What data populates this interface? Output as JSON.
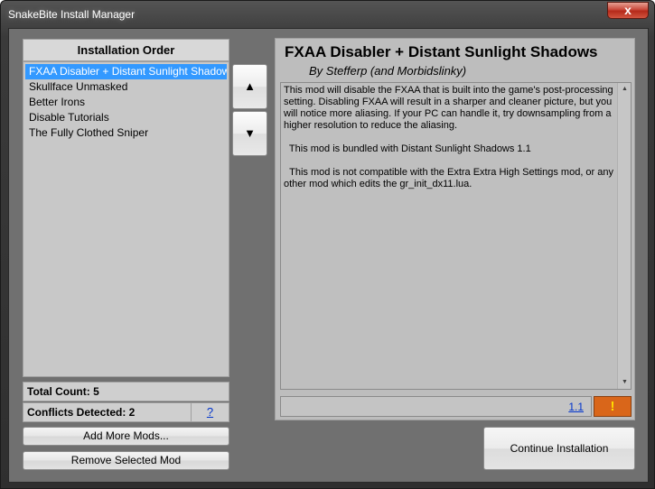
{
  "window": {
    "title": "SnakeBite Install Manager",
    "close_glyph": "x"
  },
  "installation_order": {
    "header": "Installation Order",
    "items": [
      {
        "label": "FXAA Disabler + Distant Sunlight Shadows",
        "selected": true
      },
      {
        "label": "Skullface Unmasked",
        "selected": false
      },
      {
        "label": "Better Irons",
        "selected": false
      },
      {
        "label": "Disable Tutorials",
        "selected": false
      },
      {
        "label": "The Fully Clothed Sniper",
        "selected": false
      }
    ],
    "move_up_glyph": "▲",
    "move_down_glyph": "▼"
  },
  "stats": {
    "total_count": "Total Count: 5",
    "conflicts_detected": "Conflicts Detected: 2",
    "help_label": "?"
  },
  "buttons": {
    "add_more_mods": "Add More Mods...",
    "remove_selected_mod": "Remove Selected Mod",
    "continue_installation": "Continue Installation"
  },
  "mod_details": {
    "title": "FXAA Disabler + Distant Sunlight Shadows",
    "author": "By Stefferp (and Morbidslinky)",
    "description": [
      "This mod will disable the FXAA that is built into the game's post-processing setting. Disabling FXAA will result in a sharper and cleaner picture, but you will notice more aliasing. If your PC can handle it, try downsampling from a higher resolution to reduce the aliasing.",
      "  This mod is bundled with Distant Sunlight Shadows 1.1",
      "  This mod is not compatible with the Extra Extra High Settings mod, or any other mod which edits the gr_init_dx11.lua."
    ],
    "version": "1.1",
    "warning_glyph": "!"
  },
  "colors": {
    "selection": "#3399ff",
    "warning": "#d9661a",
    "window_frame": "#3a3a3a"
  }
}
